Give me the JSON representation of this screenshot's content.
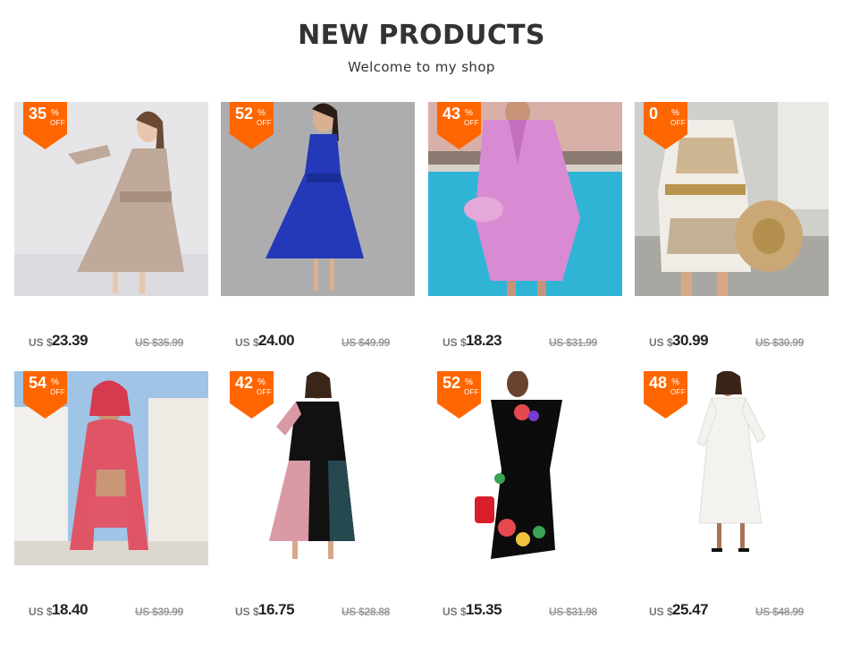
{
  "header": {
    "title": "NEW PRODUCTS",
    "subtitle": "Welcome to my shop"
  },
  "badge_percent_sign": "%",
  "badge_off_label": "OFF",
  "currency_prefix": "US $",
  "products": [
    {
      "discount": "35",
      "price": "23.39",
      "original_price": "US $35.99",
      "image": "polka-dot-dress-photo"
    },
    {
      "discount": "52",
      "price": "24.00",
      "original_price": "US $49.99",
      "image": "blue-lace-gown-photo"
    },
    {
      "discount": "43",
      "price": "18.23",
      "original_price": "US $31.99",
      "image": "pink-blazer-dress-photo"
    },
    {
      "discount": "0",
      "price": "30.99",
      "original_price": "US $30.99",
      "image": "printed-shorts-set-photo"
    },
    {
      "discount": "54",
      "price": "18.40",
      "original_price": "US $39.99",
      "image": "red-print-two-piece-photo"
    },
    {
      "discount": "42",
      "price": "16.75",
      "original_price": "US $28.88",
      "image": "black-pink-maxi-dress-photo"
    },
    {
      "discount": "52",
      "price": "15.35",
      "original_price": "US $31.98",
      "image": "floral-mermaid-dress-photo"
    },
    {
      "discount": "48",
      "price": "25.47",
      "original_price": "US $48.99",
      "image": "white-lace-dress-photo"
    }
  ],
  "colors": {
    "badge": "#ff6600",
    "title": "#333333",
    "price": "#222222",
    "original_price": "#999999"
  }
}
